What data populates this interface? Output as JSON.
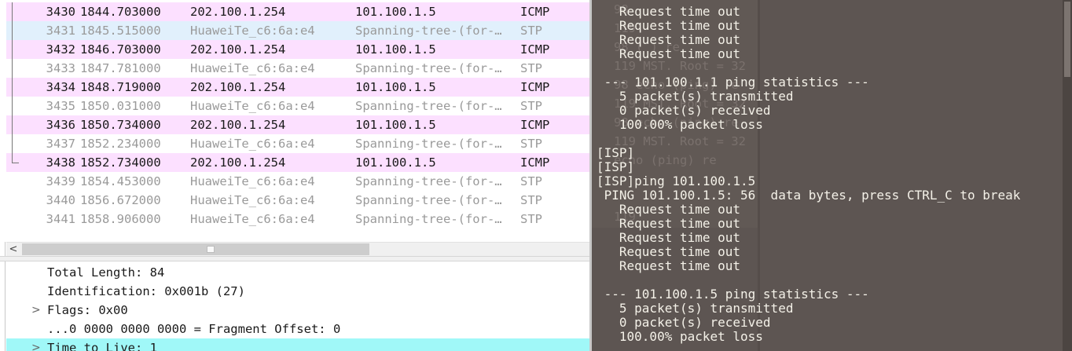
{
  "packet_list": {
    "rows": [
      {
        "no": "3430",
        "time": "1844.703000",
        "src": "202.100.1.254",
        "dst": "101.100.1.5",
        "proto": "ICMP",
        "kind": "icmp"
      },
      {
        "no": "3431",
        "time": "1845.515000",
        "src": "HuaweiTe_c6:6a:e4",
        "dst": "Spanning-tree-(for-…",
        "proto": "STP",
        "kind": "stp-sel"
      },
      {
        "no": "3432",
        "time": "1846.703000",
        "src": "202.100.1.254",
        "dst": "101.100.1.5",
        "proto": "ICMP",
        "kind": "icmp"
      },
      {
        "no": "3433",
        "time": "1847.781000",
        "src": "HuaweiTe_c6:6a:e4",
        "dst": "Spanning-tree-(for-…",
        "proto": "STP",
        "kind": "stp"
      },
      {
        "no": "3434",
        "time": "1848.719000",
        "src": "202.100.1.254",
        "dst": "101.100.1.5",
        "proto": "ICMP",
        "kind": "icmp"
      },
      {
        "no": "3435",
        "time": "1850.031000",
        "src": "HuaweiTe_c6:6a:e4",
        "dst": "Spanning-tree-(for-…",
        "proto": "STP",
        "kind": "stp"
      },
      {
        "no": "3436",
        "time": "1850.734000",
        "src": "202.100.1.254",
        "dst": "101.100.1.5",
        "proto": "ICMP",
        "kind": "icmp"
      },
      {
        "no": "3437",
        "time": "1852.234000",
        "src": "HuaweiTe_c6:6a:e4",
        "dst": "Spanning-tree-(for-…",
        "proto": "STP",
        "kind": "stp"
      },
      {
        "no": "3438",
        "time": "1852.734000",
        "src": "202.100.1.254",
        "dst": "101.100.1.5",
        "proto": "ICMP",
        "kind": "icmp"
      },
      {
        "no": "3439",
        "time": "1854.453000",
        "src": "HuaweiTe_c6:6a:e4",
        "dst": "Spanning-tree-(for-…",
        "proto": "STP",
        "kind": "stp"
      },
      {
        "no": "3440",
        "time": "1856.672000",
        "src": "HuaweiTe_c6:6a:e4",
        "dst": "Spanning-tree-(for-…",
        "proto": "STP",
        "kind": "stp"
      },
      {
        "no": "3441",
        "time": "1858.906000",
        "src": "HuaweiTe_c6:6a:e4",
        "dst": "Spanning-tree-(for-…",
        "proto": "STP",
        "kind": "stp"
      }
    ]
  },
  "scrollbar": {
    "left_arrow": "<"
  },
  "packet_details": {
    "rows": [
      {
        "text": "Total Length: 84",
        "expander": "",
        "highlight": false
      },
      {
        "text": "Identification: 0x001b (27)",
        "expander": "",
        "highlight": false
      },
      {
        "text": "Flags: 0x00",
        "expander": ">",
        "highlight": false
      },
      {
        "text": "...0 0000 0000 0000 = Fragment Offset: 0",
        "expander": "",
        "highlight": false
      },
      {
        "text": "Time to Live: 1",
        "expander": ">",
        "highlight": true
      }
    ]
  },
  "terminal": {
    "background_ghost": [
      "98",
      "119",
      "98 ( ) re",
      "119 MST. Root = 32",
      "98 echo (ping) re",
      "119 MST. Root = 32",
      "98 echo (ping) re",
      "119 MST. Root = 32",
      "echo (ping) re",
      "",
      "",
      "119"
    ],
    "lines": [
      "   Request time out",
      "   Request time out",
      "   Request time out",
      "   Request time out",
      "",
      " --- 101.100.1.1 ping statistics ---",
      "   5 packet(s) transmitted",
      "   0 packet(s) received",
      "   100.00% packet loss",
      "",
      "[ISP]",
      "[ISP]",
      "[ISP]ping 101.100.1.5",
      " PING 101.100.1.5: 56  data bytes, press CTRL_C to break",
      "   Request time out",
      "   Request time out",
      "   Request time out",
      "   Request time out",
      "   Request time out",
      "",
      " --- 101.100.1.5 ping statistics ---",
      "   5 packet(s) transmitted",
      "   0 packet(s) received",
      "   100.00% packet loss"
    ]
  },
  "colors": {
    "icmp_row": "#fce0ff",
    "selected_row": "#e1f0fc",
    "ttl_highlight": "#a0f8f8",
    "terminal_bg": "#5d5552",
    "terminal_fg": "#f4f1e8"
  }
}
